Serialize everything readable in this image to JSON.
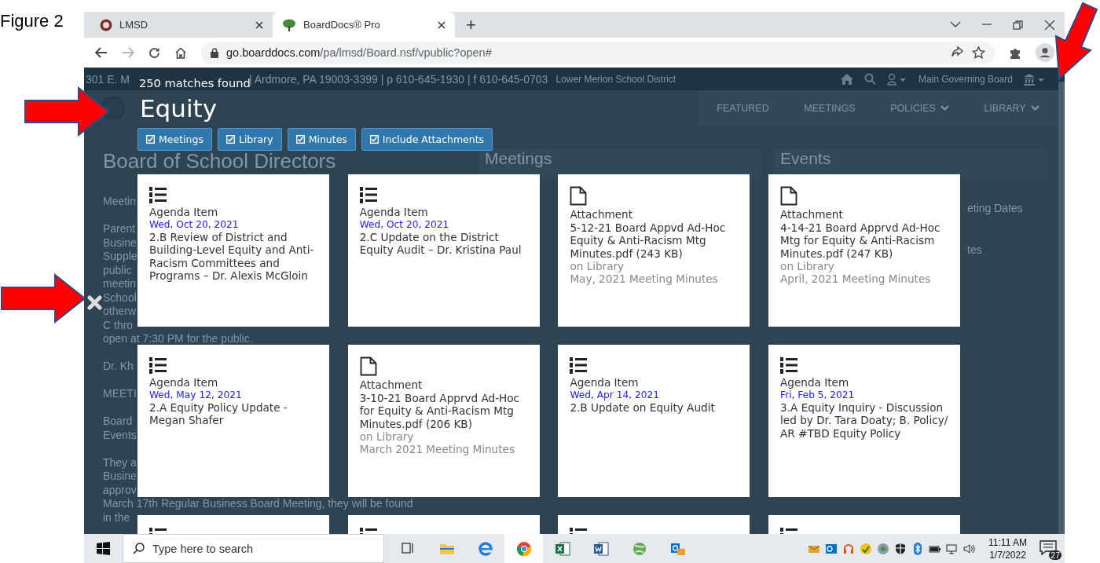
{
  "figure_label": "Figure 2",
  "browser": {
    "tabs": [
      {
        "title": "LMSD",
        "selected": false
      },
      {
        "title": "BoardDocs® Pro",
        "selected": true
      }
    ],
    "new_tab": "+",
    "forward_disabled": true,
    "url": {
      "host": "go.boarddocs.com",
      "path": "/pa/lmsd/Board.nsf/vpublic?open#"
    }
  },
  "site": {
    "address_parts": [
      "301 E. M",
      "| Ardmore, PA 19003-3399 | p 610-645-1930 | f 610-645-0703"
    ],
    "district": "Lower Merion School District",
    "board": "Main Governing Board",
    "nav": [
      {
        "label": "FEATURED",
        "dropdown": false
      },
      {
        "label": "MEETINGS",
        "dropdown": false
      },
      {
        "label": "POLICIES",
        "dropdown": true
      },
      {
        "label": "LIBRARY",
        "dropdown": true
      }
    ],
    "heading": "Board of School Directors",
    "paragraphs": [
      [
        "Meetin"
      ],
      [
        "Parent",
        "Busine",
        "Supple",
        "public",
        "meetin",
        "School",
        "otherw",
        "C thro",
        "open at 7:30 PM for the public."
      ],
      [
        "Dr. Kh"
      ],
      [
        "MEETI"
      ],
      [
        "Board",
        "Events"
      ],
      [
        "They a",
        "Busine",
        "approv",
        "March 17th Regular Business Board Meeting, they will be found",
        "in the"
      ]
    ],
    "meetings_title": "Meetings",
    "events_title": "Events",
    "events_lines": [
      "eting Dates",
      "tes"
    ]
  },
  "search": {
    "count": "250 matches found",
    "query": "Equity",
    "filters": [
      {
        "label": "Meetings",
        "checked": true
      },
      {
        "label": "Library",
        "checked": true
      },
      {
        "label": "Minutes",
        "checked": true
      },
      {
        "label": "Include Attachments",
        "checked": true
      }
    ],
    "results": [
      {
        "kind": "agenda",
        "type": "Agenda Item",
        "date": "Wed, Oct 20, 2021",
        "title": "2.B Review of District and Building-Level Equity and Anti-Racism Committees and Programs – Dr. Alexis McGloin"
      },
      {
        "kind": "agenda",
        "type": "Agenda Item",
        "date": "Wed, Oct 20, 2021",
        "title": "2.C Update on the District Equity Audit – Dr. Kristina Paul"
      },
      {
        "kind": "attachment",
        "type": "Attachment",
        "title": "5-12-21 Board Appvd Ad-Hoc Equity & Anti-Racism Mtg Minutes.pdf (243 KB)",
        "location": "on Library",
        "meeting": "May, 2021 Meeting Minutes"
      },
      {
        "kind": "attachment",
        "type": "Attachment",
        "title": "4-14-21 Board Apprvd Ad-Hoc Mtg for Equity & Anti-Racism Minutes.pdf (247 KB)",
        "location": "on Library",
        "meeting": "April, 2021 Meeting Minutes"
      },
      {
        "kind": "agenda",
        "type": "Agenda Item",
        "date": "Wed, May 12, 2021",
        "title": "2.A Equity Policy Update - Megan Shafer"
      },
      {
        "kind": "attachment",
        "type": "Attachment",
        "title": "3-10-21 Board Apprvd Ad-Hoc for Equity & Anti-Racism Mtg Minutes.pdf (206 KB)",
        "location": "on Library",
        "meeting": "March 2021 Meeting Minutes"
      },
      {
        "kind": "agenda",
        "type": "Agenda Item",
        "date": "Wed, Apr 14, 2021",
        "title": "2.B Update on Equity Audit"
      },
      {
        "kind": "agenda",
        "type": "Agenda Item",
        "date": "Fri, Feb 5, 2021",
        "title": "3.A Equity Inquiry - Discussion led by Dr. Tara Doaty; B. Policy/ AR #TBD Equity Policy"
      },
      {
        "kind": "agenda"
      },
      {
        "kind": "agenda"
      },
      {
        "kind": "agenda"
      },
      {
        "kind": "agenda"
      }
    ]
  },
  "taskbar": {
    "search_placeholder": "Type here to search",
    "time": "11:11 AM",
    "date": "1/7/2022",
    "notifications": "27"
  }
}
